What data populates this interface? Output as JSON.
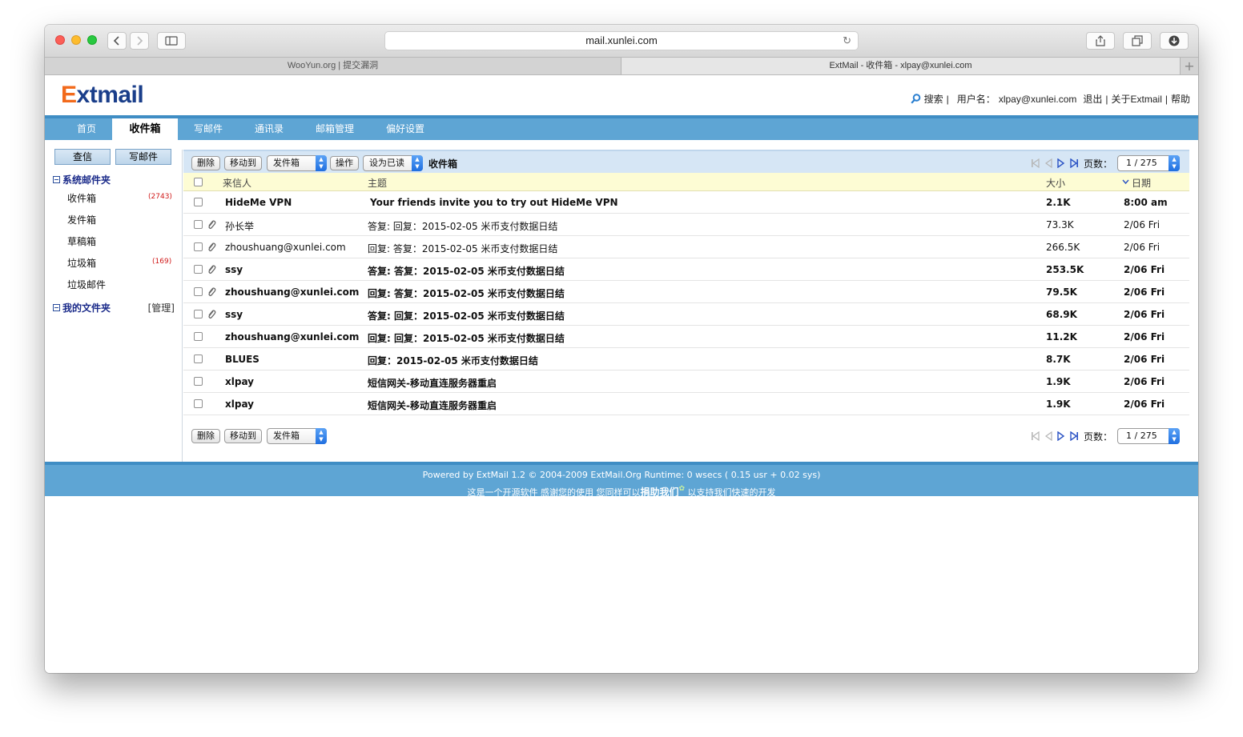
{
  "browser": {
    "url": "mail.xunlei.com",
    "tabs": [
      {
        "label": "WooYun.org | 提交漏洞"
      },
      {
        "label": "ExtMail - 收件箱 - xlpay@xunlei.com"
      }
    ]
  },
  "header": {
    "logo": {
      "first": "E",
      "rest": "xtmail"
    },
    "search": "搜索",
    "sep": "|",
    "username_label": "用户名：",
    "username": "xlpay@xunlei.com",
    "logout": "退出",
    "about": "关于Extmail",
    "help": "帮助"
  },
  "nav": [
    {
      "label": "首页"
    },
    {
      "label": "收件箱"
    },
    {
      "label": "写邮件"
    },
    {
      "label": "通讯录"
    },
    {
      "label": "邮箱管理"
    },
    {
      "label": "偏好设置"
    }
  ],
  "sidebar": {
    "check_mail": "查信",
    "compose": "写邮件",
    "system_folders": "系统邮件夹",
    "folders": [
      {
        "label": "收件箱",
        "count": "(2743)"
      },
      {
        "label": "发件箱",
        "count": ""
      },
      {
        "label": "草稿箱",
        "count": ""
      },
      {
        "label": "垃圾箱",
        "count": "(169)"
      },
      {
        "label": "垃圾邮件",
        "count": ""
      }
    ],
    "my_folders": "我的文件夹",
    "manage": "[管理]"
  },
  "toolbar": {
    "delete": "删除",
    "move_to": "移动到",
    "move_target": "发件箱",
    "action": "操作",
    "mark_as": "设为已读",
    "folder_title": "收件箱",
    "page_label": "页数：",
    "page_value": "1 / 275"
  },
  "table": {
    "headers": {
      "from": "来信人",
      "subject": "主题",
      "size": "大小",
      "date": "日期"
    },
    "rows": [
      {
        "from": "HideMe VPN",
        "subject": "Your friends invite you to try out HideMe VPN",
        "size": "2.1K",
        "date": "8:00 am",
        "unread": true,
        "attachment": false
      },
      {
        "from": "孙长举",
        "subject": "答复: 回复：2015-02-05 米币支付数据日结",
        "size": "73.3K",
        "date": "2/06 Fri",
        "unread": false,
        "attachment": true
      },
      {
        "from": "zhoushuang@xunlei.com",
        "subject": "回复: 答复：2015-02-05 米币支付数据日结",
        "size": "266.5K",
        "date": "2/06 Fri",
        "unread": false,
        "attachment": true
      },
      {
        "from": "ssy",
        "subject": "答复: 答复：2015-02-05 米币支付数据日结",
        "size": "253.5K",
        "date": "2/06 Fri",
        "unread": true,
        "attachment": true
      },
      {
        "from": "zhoushuang@xunlei.com",
        "subject": "回复: 答复：2015-02-05 米币支付数据日结",
        "size": "79.5K",
        "date": "2/06 Fri",
        "unread": true,
        "attachment": true
      },
      {
        "from": "ssy",
        "subject": "答复: 回复：2015-02-05 米币支付数据日结",
        "size": "68.9K",
        "date": "2/06 Fri",
        "unread": true,
        "attachment": true
      },
      {
        "from": "zhoushuang@xunlei.com",
        "subject": "回复: 回复：2015-02-05 米币支付数据日结",
        "size": "11.2K",
        "date": "2/06 Fri",
        "unread": true,
        "attachment": false
      },
      {
        "from": "BLUES",
        "subject": "回复：2015-02-05 米币支付数据日结",
        "size": "8.7K",
        "date": "2/06 Fri",
        "unread": true,
        "attachment": false
      },
      {
        "from": "xlpay",
        "subject": "短信网关-移动直连服务器重启",
        "size": "1.9K",
        "date": "2/06 Fri",
        "unread": true,
        "attachment": false
      },
      {
        "from": "xlpay",
        "subject": "短信网关-移动直连服务器重启",
        "size": "1.9K",
        "date": "2/06 Fri",
        "unread": true,
        "attachment": false
      }
    ]
  },
  "footer": {
    "powered": "Powered by ExtMail 1.2 © 2004-2009 ExtMail.Org Runtime: 0 wsecs ( 0.15 usr + 0.02 sys)",
    "line2_pre": "这是一个开源软件 感谢您的使用 您同样可以",
    "donate": "捐助我们",
    "line2_post": " 以支持我们快速的开发"
  }
}
